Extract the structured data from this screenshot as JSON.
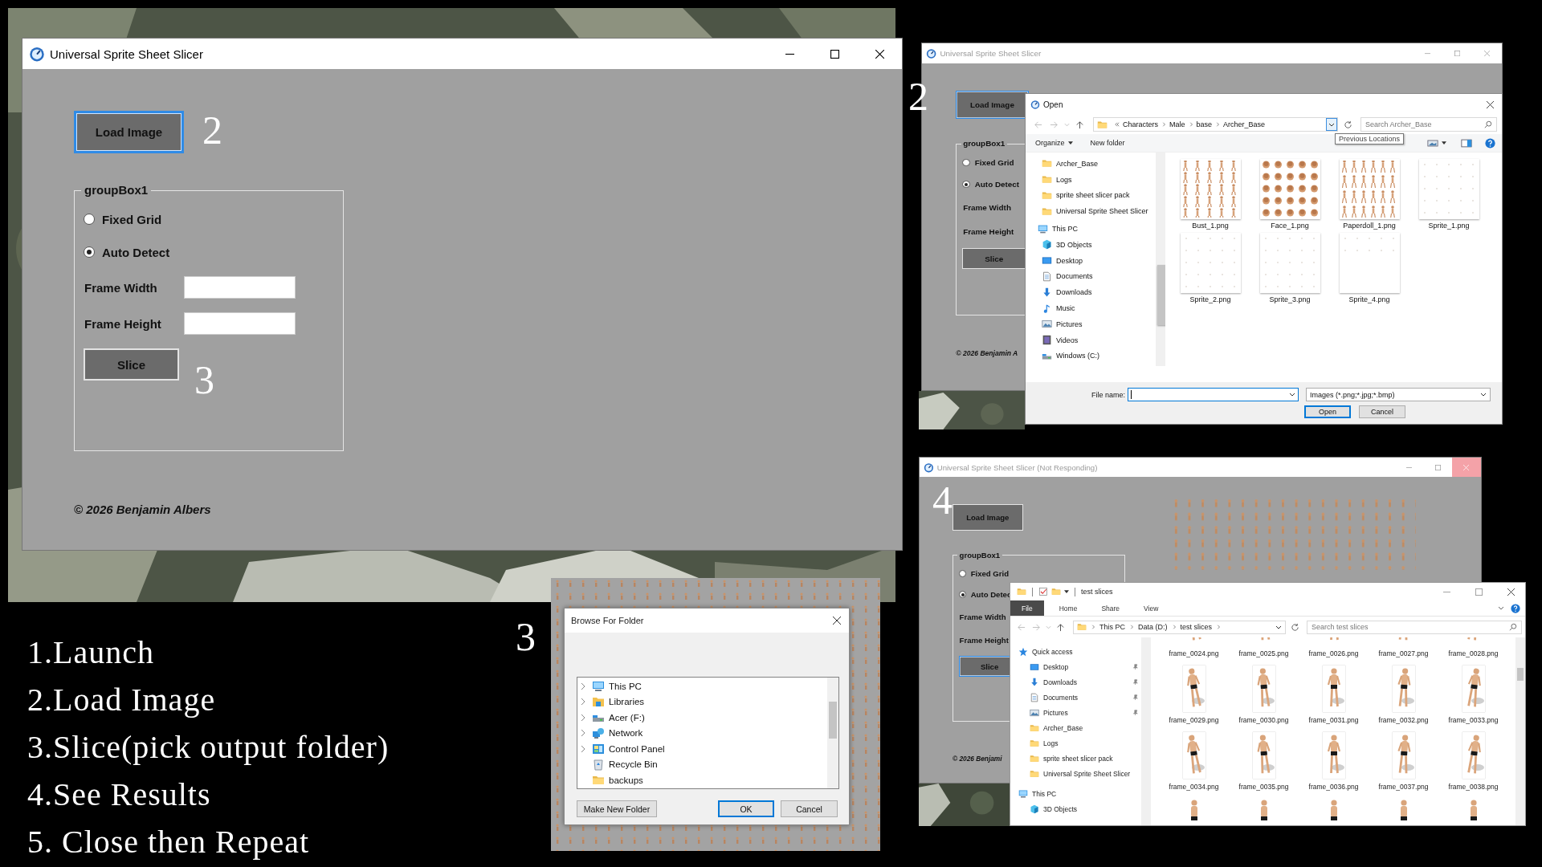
{
  "slicer_windows": [
    {
      "title": "Universal Sprite Sheet Slicer",
      "active": true,
      "close_hovered": false,
      "load_button": {
        "label": "Load Image",
        "focused": true
      },
      "group_title": "groupBox1",
      "options": [
        {
          "label": "Fixed Grid",
          "selected": false
        },
        {
          "label": "Auto Detect",
          "selected": true
        }
      ],
      "fields": [
        {
          "label": "Frame Width",
          "kind": "input"
        },
        {
          "label": "Frame Height",
          "kind": "input"
        }
      ],
      "slice_button": {
        "label": "Slice",
        "focused": false
      },
      "footer": "© 2026 Benjamin Albers"
    },
    {
      "title": "Universal Sprite Sheet Slicer",
      "active": false,
      "close_hovered": false,
      "load_button": {
        "label": "Load Image",
        "focused": true
      },
      "group_title": "groupBox1",
      "options": [
        {
          "label": "Fixed Grid",
          "selected": false
        },
        {
          "label": "Auto Detect",
          "selected": true
        }
      ],
      "fields": [
        {
          "label": "Frame Width",
          "kind": "label"
        },
        {
          "label": "Frame Height",
          "kind": "label"
        }
      ],
      "slice_button": {
        "label": "Slice",
        "focused": false
      },
      "footer": "© 2026 Benjamin A"
    },
    {
      "title": "Universal Sprite Sheet Slicer (Not Responding)",
      "active": false,
      "close_hovered": true,
      "load_button": {
        "label": "Load Image",
        "focused": false
      },
      "group_title": "groupBox1",
      "options": [
        {
          "label": "Fixed Grid",
          "selected": false
        },
        {
          "label": "Auto Detec",
          "selected": true
        }
      ],
      "fields": [
        {
          "label": "Frame Width",
          "kind": "label"
        },
        {
          "label": "Frame Height",
          "kind": "label"
        }
      ],
      "slice_button": {
        "label": "Slice",
        "focused": true
      },
      "footer": "© 2026 Benjami",
      "preview": {
        "kind": "picture"
      }
    }
  ],
  "step_marks": [
    "2",
    "3",
    "3",
    "2",
    "4"
  ],
  "steps": [
    "1.Launch",
    "2.Load Image",
    "3.Slice(pick output folder)",
    "4.See Results",
    "5. Close then Repeat"
  ],
  "browse_dialog": {
    "title": "Browse For Folder",
    "items": [
      {
        "label": "This PC",
        "kind": "pc",
        "expandable": true
      },
      {
        "label": "Libraries",
        "kind": "library",
        "expandable": true
      },
      {
        "label": "Acer (F:)",
        "kind": "drive",
        "expandable": true
      },
      {
        "label": "Network",
        "kind": "network",
        "expandable": true
      },
      {
        "label": "Control Panel",
        "kind": "panel",
        "expandable": true
      },
      {
        "label": "Recycle Bin",
        "kind": "bin",
        "expandable": false
      },
      {
        "label": "backups",
        "kind": "folder",
        "expandable": false
      }
    ],
    "buttons": [
      {
        "label": "Make New Folder",
        "default": false
      },
      {
        "label": "OK",
        "default": true
      },
      {
        "label": "Cancel",
        "default": false
      }
    ]
  },
  "open_dialog": {
    "title": "Open",
    "path": [
      "Characters",
      "Male",
      "base",
      "Archer_Base"
    ],
    "search_placeholder": "Search Archer_Base",
    "tooltip": "Previous Locations",
    "toolbar": [
      {
        "label": "Organize",
        "menu": true
      },
      {
        "label": "New folder",
        "menu": false
      }
    ],
    "nav": [
      {
        "label": "Archer_Base",
        "kind": "folder"
      },
      {
        "label": "Logs",
        "kind": "folder"
      },
      {
        "label": "sprite sheet slicer pack",
        "kind": "folder"
      },
      {
        "label": "Universal Sprite Sheet Slicer",
        "kind": "folder"
      },
      {
        "label": "This PC",
        "kind": "pc",
        "children": [
          {
            "label": "3D Objects",
            "kind": "cube"
          },
          {
            "label": "Desktop",
            "kind": "desktop"
          },
          {
            "label": "Documents",
            "kind": "documents"
          },
          {
            "label": "Downloads",
            "kind": "downloads"
          },
          {
            "label": "Music",
            "kind": "music"
          },
          {
            "label": "Pictures",
            "kind": "pictures"
          },
          {
            "label": "Videos",
            "kind": "videos"
          },
          {
            "label": "Windows (C:)",
            "kind": "drive"
          }
        ]
      }
    ],
    "files": [
      {
        "name": "Bust_1.png"
      },
      {
        "name": "Face_1.png"
      },
      {
        "name": "Paperdoll_1.png"
      },
      {
        "name": "Sprite_1.png"
      },
      {
        "name": "Sprite_2.png"
      },
      {
        "name": "Sprite_3.png"
      },
      {
        "name": "Sprite_4.png"
      }
    ],
    "file_name_label": "File name:",
    "file_type": "Images (*.png;*.jpg;*.bmp)",
    "buttons": [
      {
        "label": "Open",
        "default": true
      },
      {
        "label": "Cancel",
        "default": false
      }
    ]
  },
  "explorer": {
    "title": "test slices",
    "tabs": [
      {
        "label": "File",
        "selected": true
      },
      {
        "label": "Home",
        "selected": false
      },
      {
        "label": "Share",
        "selected": false
      },
      {
        "label": "View",
        "selected": false
      }
    ],
    "path": [
      "This PC",
      "Data (D:)",
      "test slices"
    ],
    "search_placeholder": "Search test slices",
    "nav": [
      {
        "label": "Quick access",
        "kind": "star",
        "children": [
          {
            "label": "Desktop",
            "kind": "desktop",
            "pinned": true
          },
          {
            "label": "Downloads",
            "kind": "downloads",
            "pinned": true
          },
          {
            "label": "Documents",
            "kind": "documents",
            "pinned": true
          },
          {
            "label": "Pictures",
            "kind": "pictures",
            "pinned": true
          },
          {
            "label": "Archer_Base",
            "kind": "folder",
            "pinned": false
          },
          {
            "label": "Logs",
            "kind": "folder",
            "pinned": false
          },
          {
            "label": "sprite sheet slicer pack",
            "kind": "folder",
            "pinned": false
          },
          {
            "label": "Universal Sprite Sheet Slicer",
            "kind": "folder",
            "pinned": false
          }
        ]
      },
      {
        "label": "This PC",
        "kind": "pc",
        "children": [
          {
            "label": "3D Objects",
            "kind": "cube",
            "pinned": false
          }
        ]
      }
    ],
    "files": [
      {
        "name": "frame_0024.png"
      },
      {
        "name": "frame_0025.png"
      },
      {
        "name": "frame_0026.png"
      },
      {
        "name": "frame_0027.png"
      },
      {
        "name": "frame_0028.png"
      },
      {
        "name": "frame_0029.png"
      },
      {
        "name": "frame_0030.png"
      },
      {
        "name": "frame_0031.png"
      },
      {
        "name": "frame_0032.png"
      },
      {
        "name": "frame_0033.png"
      },
      {
        "name": "frame_0034.png"
      },
      {
        "name": "frame_0035.png"
      },
      {
        "name": "frame_0036.png"
      },
      {
        "name": "frame_0037.png"
      },
      {
        "name": "frame_0038.png"
      }
    ],
    "cut_thumbnails": [
      {
        "kind": "picture"
      },
      {
        "kind": "picture"
      },
      {
        "kind": "picture"
      },
      {
        "kind": "picture"
      },
      {
        "kind": "picture"
      }
    ]
  }
}
